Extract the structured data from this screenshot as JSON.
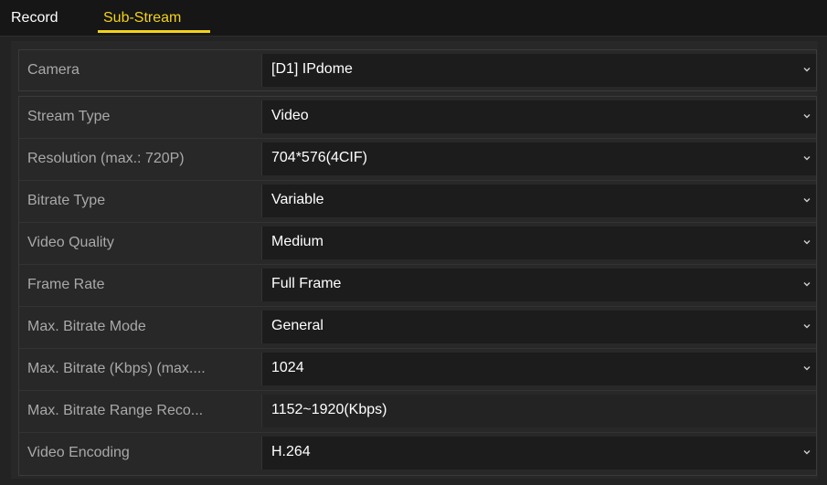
{
  "tabs": [
    {
      "label": "Record"
    },
    {
      "label": "Sub-Stream"
    }
  ],
  "camera": {
    "label": "Camera",
    "value": "[D1] IPdome"
  },
  "settings": [
    {
      "label": "Stream Type",
      "value": "Video",
      "dropdown": true
    },
    {
      "label": "Resolution (max.: 720P)",
      "value": "704*576(4CIF)",
      "dropdown": true
    },
    {
      "label": "Bitrate Type",
      "value": "Variable",
      "dropdown": true
    },
    {
      "label": "Video Quality",
      "value": "Medium",
      "dropdown": true
    },
    {
      "label": "Frame Rate",
      "value": "Full Frame",
      "dropdown": true
    },
    {
      "label": "Max. Bitrate Mode",
      "value": "General",
      "dropdown": true
    },
    {
      "label": "Max. Bitrate (Kbps) (max....",
      "value": "1024",
      "dropdown": true
    },
    {
      "label": "Max. Bitrate Range Reco...",
      "value": "1152~1920(Kbps)",
      "dropdown": false
    },
    {
      "label": "Video Encoding",
      "value": "H.264",
      "dropdown": true
    }
  ],
  "icons": {
    "dropdown": "chevron-down-icon"
  },
  "colors": {
    "active_tab": "#f3d21a",
    "background": "#232323",
    "label_text": "#a9a9a9",
    "value_text": "#ffffff"
  }
}
